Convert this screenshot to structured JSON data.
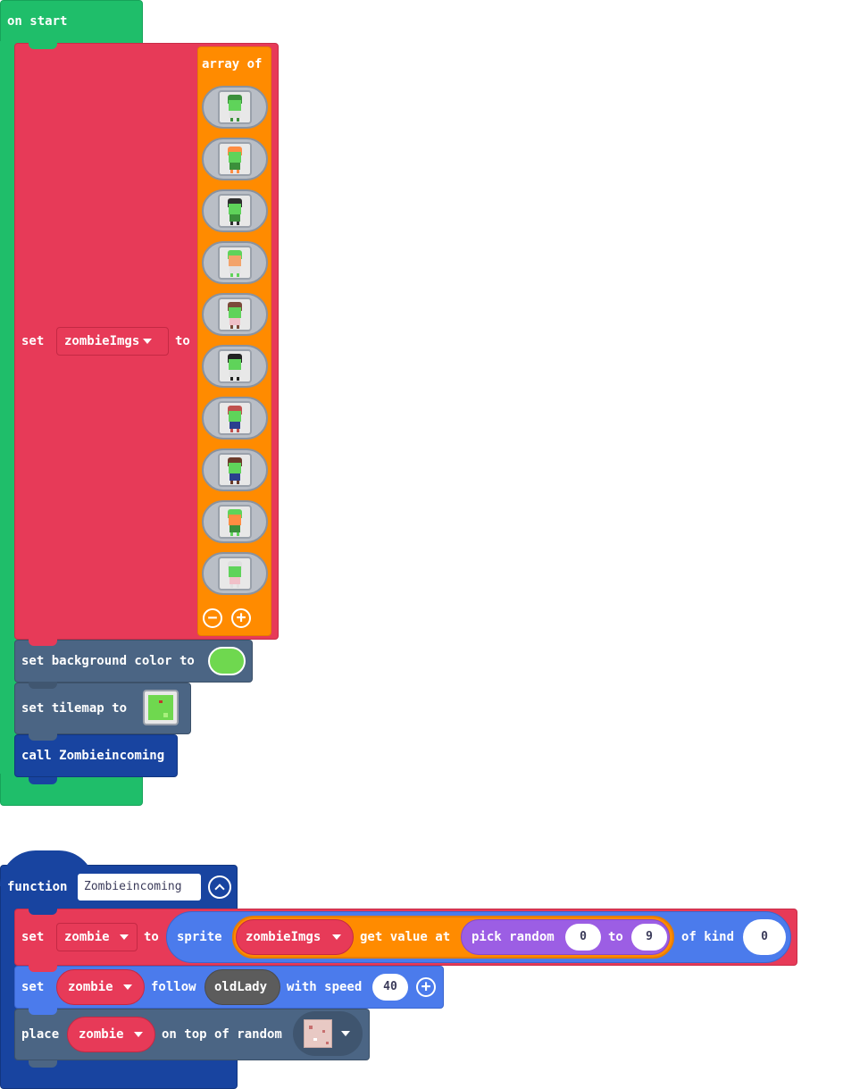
{
  "on_start": {
    "hat_label": "on start",
    "set_label": "set",
    "variable": "zombieImgs",
    "to_label": "to",
    "array_label": "array of",
    "images": [
      "zombie-1",
      "zombie-2",
      "zombie-3",
      "zombie-4",
      "zombie-5",
      "zombie-6",
      "zombie-7",
      "zombie-8",
      "zombie-9",
      "zombie-10"
    ],
    "bg_label": "set background color to",
    "bg_color": "#6fd84f",
    "tilemap_label": "set tilemap to",
    "call_label": "call Zombieincoming"
  },
  "function_block": {
    "keyword": "function",
    "name": "Zombieincoming",
    "row1": {
      "set_label": "set",
      "variable": "zombie",
      "to_label": "to",
      "sprite_label": "sprite",
      "array_var": "zombieImgs",
      "get_value_label": "get value at",
      "pick_random_label": "pick random",
      "from_value": "0",
      "to_label2": "to",
      "to_value": "9",
      "kind_label": "of kind",
      "kind_value": "0"
    },
    "row2": {
      "set_label": "set",
      "variable": "zombie",
      "follow_label": "follow",
      "target": "oldLady",
      "speed_label": "with speed",
      "speed_value": "40"
    },
    "row3": {
      "place_label": "place",
      "variable": "zombie",
      "on_top_label": "on top of random"
    }
  },
  "colors": {
    "event_green": "#1fbe6a",
    "variables_red": "#e73a58",
    "arrays_orange": "#ff8b00",
    "scene_slate": "#4b6584",
    "functions_blue": "#1844a0",
    "sprites_blue": "#4b7bec",
    "math_purple": "#9c5ee4"
  }
}
